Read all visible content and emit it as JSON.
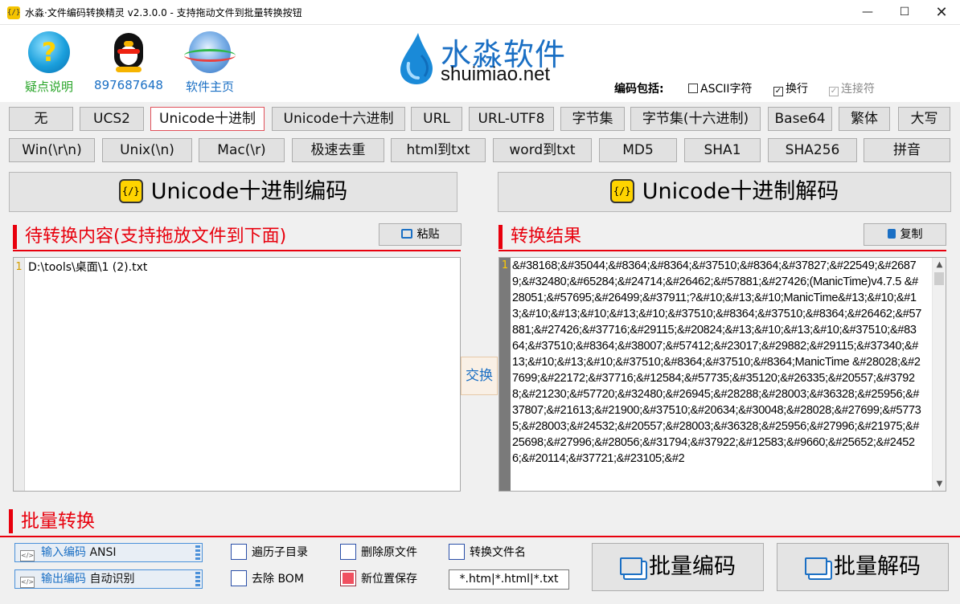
{
  "window": {
    "title": "水淼·文件编码转换精灵 v2.3.0.0 - 支持拖动文件到批量转换按钮",
    "icon": "code-icon"
  },
  "quick_links": {
    "help": "疑点说明",
    "qq": "897687648",
    "home": "软件主页"
  },
  "colors": {
    "help_label": "#2aa52a",
    "link_label": "#1a6fc4",
    "accent_red": "#e8000d",
    "brand_blue": "#1a6fc4"
  },
  "logo": {
    "brand_cn": "水淼软件",
    "brand_en": "shuimiao.net"
  },
  "encoding_include": {
    "label": "编码包括:",
    "ascii": "ASCII字符",
    "ascii_checked": false,
    "newline": "换行",
    "newline_checked": true,
    "join": "连接符",
    "join_checked": true,
    "join_enabled": false
  },
  "modes_row1": [
    "无",
    "UCS2",
    "Unicode十进制",
    "Unicode十六进制",
    "URL",
    "URL-UTF8",
    "字节集",
    "字节集(十六进制)",
    "Base64",
    "繁体",
    "大写"
  ],
  "modes_row2": [
    "Win(\\r\\n)",
    "Unix(\\n)",
    "Mac(\\r)",
    "极速去重",
    "html到txt",
    "word到txt",
    "MD5",
    "SHA1",
    "SHA256",
    "拼音"
  ],
  "active_mode": "Unicode十进制",
  "actions": {
    "encode": "Unicode十进制编码",
    "decode": "Unicode十进制解码",
    "badge": "{/}"
  },
  "input_panel": {
    "title": "待转换内容(支持拖放文件到下面)",
    "paste": "粘贴",
    "line_no": "1",
    "content": "D:\\tools\\桌面\\1 (2).txt"
  },
  "swap": "交换",
  "result_panel": {
    "title": "转换结果",
    "copy": "复制",
    "line_no": "1",
    "content": "&#38168;&#35044;&#8364;&#8364;&#37510;&#8364;&#37827;&#22549;&#26879;&#32480;&#65284;&#24714;&#26462;&#57881;&#27426;(ManicTime)v4.7.5 &#28051;&#57695;&#26499;&#37911;?&#10;&#13;&#10;ManicTime&#13;&#10;&#13;&#10;&#13;&#10;&#13;&#10;&#37510;&#8364;&#37510;&#8364;&#26462;&#57881;&#27426;&#37716;&#29115;&#20824;&#13;&#10;&#13;&#10;&#37510;&#8364;&#37510;&#8364;&#38007;&#57412;&#23017;&#29882;&#29115;&#37340;&#13;&#10;&#13;&#10;&#37510;&#8364;&#37510;&#8364;ManicTime &#28028;&#27699;&#22172;&#37716;&#12584;&#57735;&#35120;&#26335;&#20557;&#37928;&#21230;&#57720;&#32480;&#26945;&#28288;&#28003;&#36328;&#25956;&#37807;&#21613;&#21900;&#37510;&#20634;&#30048;&#28028;&#27699;&#57735;&#28003;&#24532;&#20557;&#28003;&#36328;&#25956;&#27996;&#21975;&#25698;&#27996;&#28056;&#31794;&#37922;&#12583;&#9660;&#25652;&#24526;&#20114;&#37721;&#23105;&#2"
  },
  "batch": {
    "title": "批量转换",
    "input_enc_label": "输入编码",
    "input_enc_value": "ANSI",
    "output_enc_label": "输出编码",
    "output_enc_value": "自动识别",
    "traverse": "遍历子目录",
    "traverse_checked": false,
    "remove_bom": "去除 BOM",
    "remove_bom_checked": false,
    "delete_orig": "删除原文件",
    "delete_orig_checked": false,
    "new_location": "新位置保存",
    "new_location_checked": true,
    "convert_name": "转换文件名",
    "convert_name_checked": false,
    "ext_filter": "*.htm|*.html|*.txt",
    "encode": "批量编码",
    "decode": "批量解码"
  }
}
